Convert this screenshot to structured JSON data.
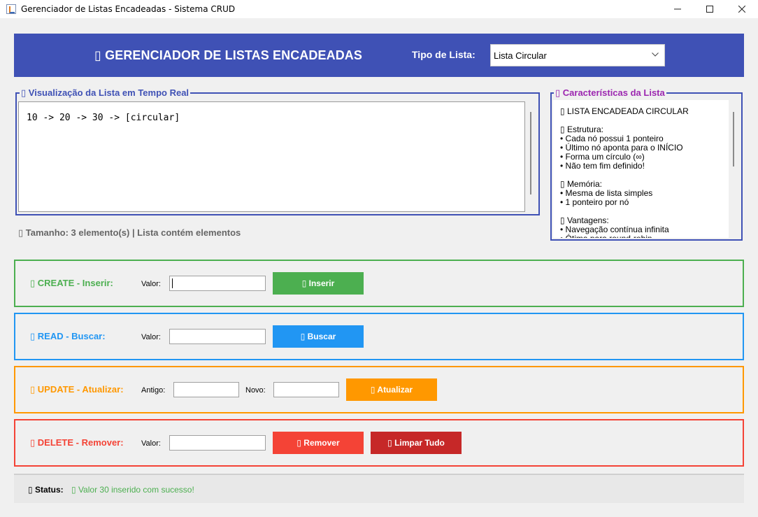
{
  "window": {
    "title": "Gerenciador de Listas Encadeadas - Sistema CRUD"
  },
  "header": {
    "title": "▯ GERENCIADOR DE LISTAS ENCADEADAS",
    "type_label": "Tipo de Lista:",
    "type_value": "Lista Circular"
  },
  "visualization": {
    "legend": "▯ Visualização da Lista em Tempo Real",
    "content": "10 -> 20 -> 30 -> [circular]"
  },
  "size_line": "▯ Tamanho: 3 elemento(s) | Lista contém elementos",
  "characteristics": {
    "legend": "▯ Características da Lista",
    "text": "▯ LISTA ENCADEADA CIRCULAR\n\n▯ Estrutura:\n• Cada nó possui 1 ponteiro\n• Último nó aponta para o INÍCIO\n• Forma um círculo (∞)\n• Não tem fim definido!\n\n▯ Memória:\n• Mesma de lista simples\n• 1 ponteiro por nó\n\n▯ Vantagens:\n• Navegação contínua infinita\n• Ótima para round-robin"
  },
  "create": {
    "label": "▯ CREATE - Inserir:",
    "value_label": "Valor:",
    "value": "",
    "button": "▯ Inserir"
  },
  "read": {
    "label": "▯ READ - Buscar:",
    "value_label": "Valor:",
    "value": "",
    "button": "▯ Buscar"
  },
  "update": {
    "label": "▯ UPDATE - Atualizar:",
    "old_label": "Antigo:",
    "old_value": "",
    "new_label": "Novo:",
    "new_value": "",
    "button": "▯ Atualizar"
  },
  "delete": {
    "label": "▯ DELETE - Remover:",
    "value_label": "Valor:",
    "value": "",
    "remove_button": "▯ Remover",
    "clear_button": "▯ Limpar Tudo"
  },
  "status": {
    "label": "▯ Status:",
    "text": "▯ Valor 30 inserido com sucesso!"
  },
  "colors": {
    "header_bg": "#3f51b5",
    "create": "#4caf50",
    "read": "#2196f3",
    "update": "#ff9800",
    "delete": "#f44336",
    "clear": "#c62828",
    "characteristics": "#9c27b0"
  },
  "icons": {
    "app": "java-app-icon",
    "minimize": "minimize-icon",
    "maximize": "maximize-icon",
    "close": "close-icon",
    "dropdown": "chevron-down-icon"
  }
}
